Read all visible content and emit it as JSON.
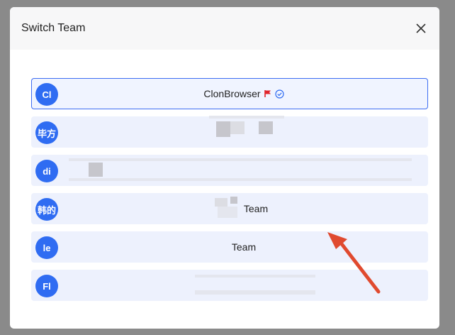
{
  "dialog": {
    "title": "Switch Team",
    "close_icon": "close-icon"
  },
  "teams": [
    {
      "avatar": "Cl",
      "name": "ClonBrowser",
      "active": true,
      "flag_color": "#e0242b",
      "verified_color": "#2f6cf2"
    },
    {
      "avatar": "毕方",
      "name": ""
    },
    {
      "avatar": "di",
      "name": ""
    },
    {
      "avatar": "韩的",
      "name": "Team"
    },
    {
      "avatar": "le",
      "name": "Team"
    },
    {
      "avatar": "Fl",
      "name": ""
    }
  ],
  "colors": {
    "accent": "#2f6cf2",
    "item_bg": "#edf1fd",
    "active_border": "#3d6df2",
    "annotation_arrow": "#e04a2f"
  }
}
